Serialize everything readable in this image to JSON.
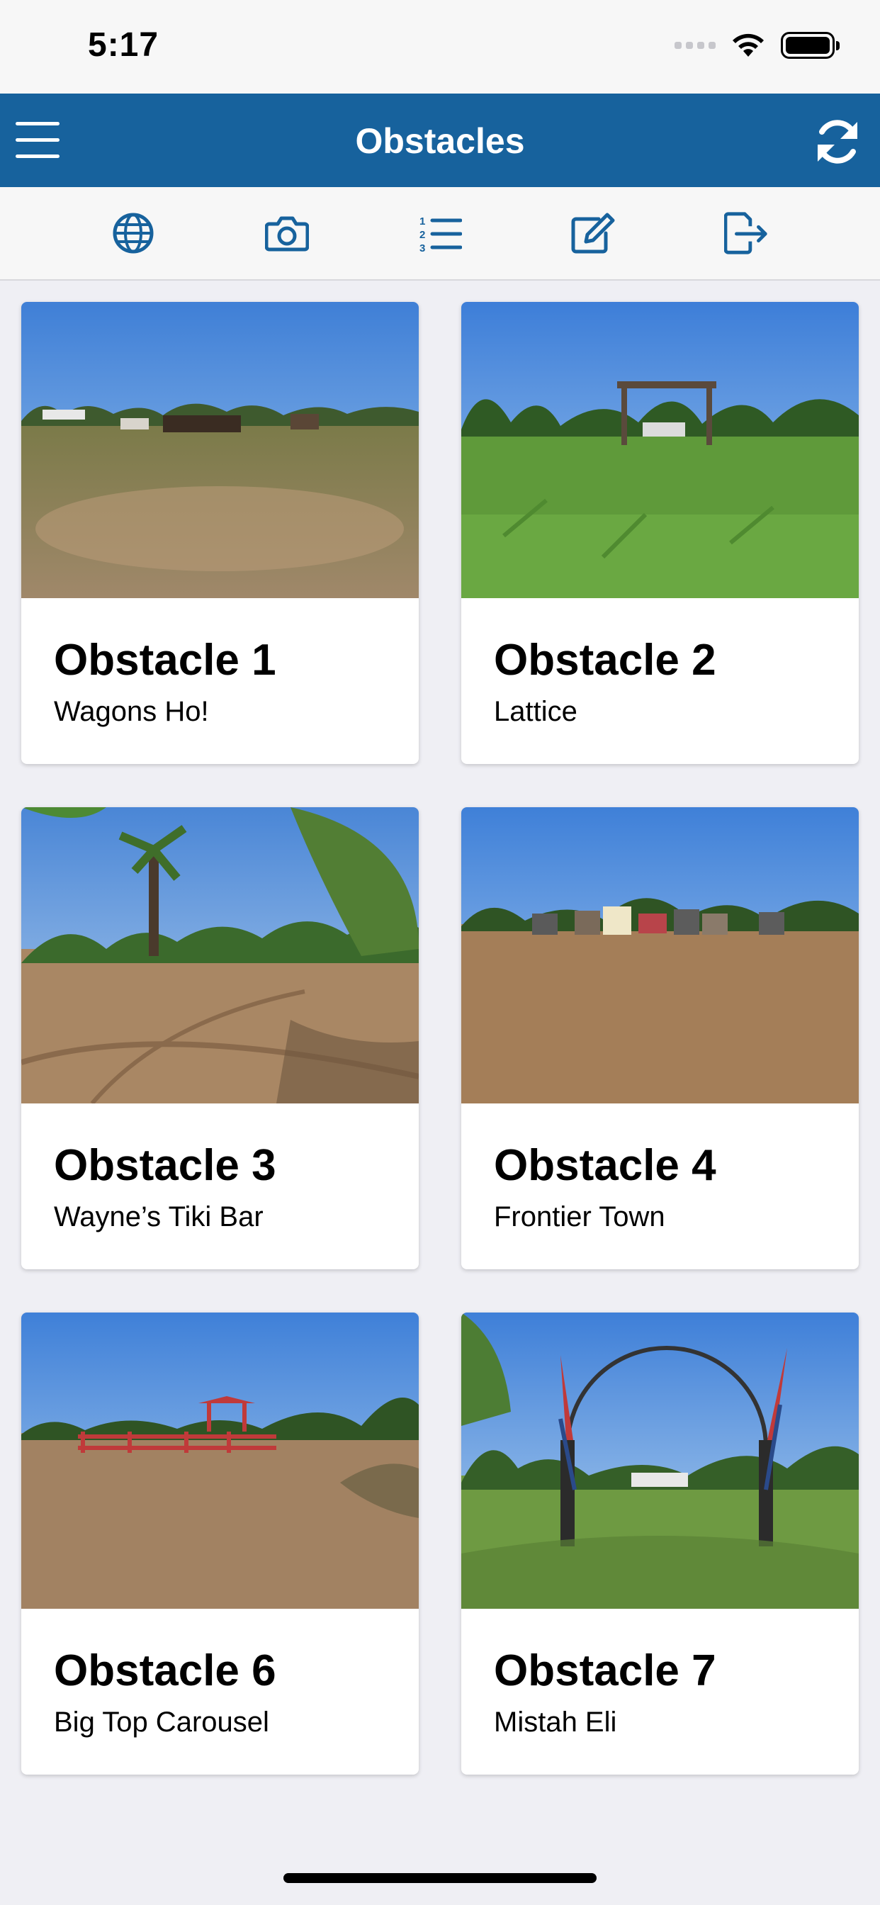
{
  "status_bar": {
    "time": "5:17"
  },
  "nav": {
    "title": "Obstacles",
    "menu_icon": "hamburger-icon",
    "refresh_icon": "refresh-icon"
  },
  "toolbar": {
    "items": [
      {
        "icon": "globe-icon"
      },
      {
        "icon": "camera-icon"
      },
      {
        "icon": "numbered-list-icon"
      },
      {
        "icon": "edit-icon"
      },
      {
        "icon": "export-icon"
      }
    ]
  },
  "colors": {
    "nav_bar": "#17629d",
    "accent_icon": "#17629d",
    "background": "#efeff4"
  },
  "cards": [
    {
      "title": "Obstacle 1",
      "subtitle": "Wagons Ho!"
    },
    {
      "title": "Obstacle 2",
      "subtitle": "Lattice"
    },
    {
      "title": "Obstacle 3",
      "subtitle": "Wayne’s Tiki Bar"
    },
    {
      "title": "Obstacle 4",
      "subtitle": "Frontier Town"
    },
    {
      "title": "Obstacle 6",
      "subtitle": "Big Top Carousel"
    },
    {
      "title": "Obstacle 7",
      "subtitle": "Mistah Eli"
    }
  ]
}
